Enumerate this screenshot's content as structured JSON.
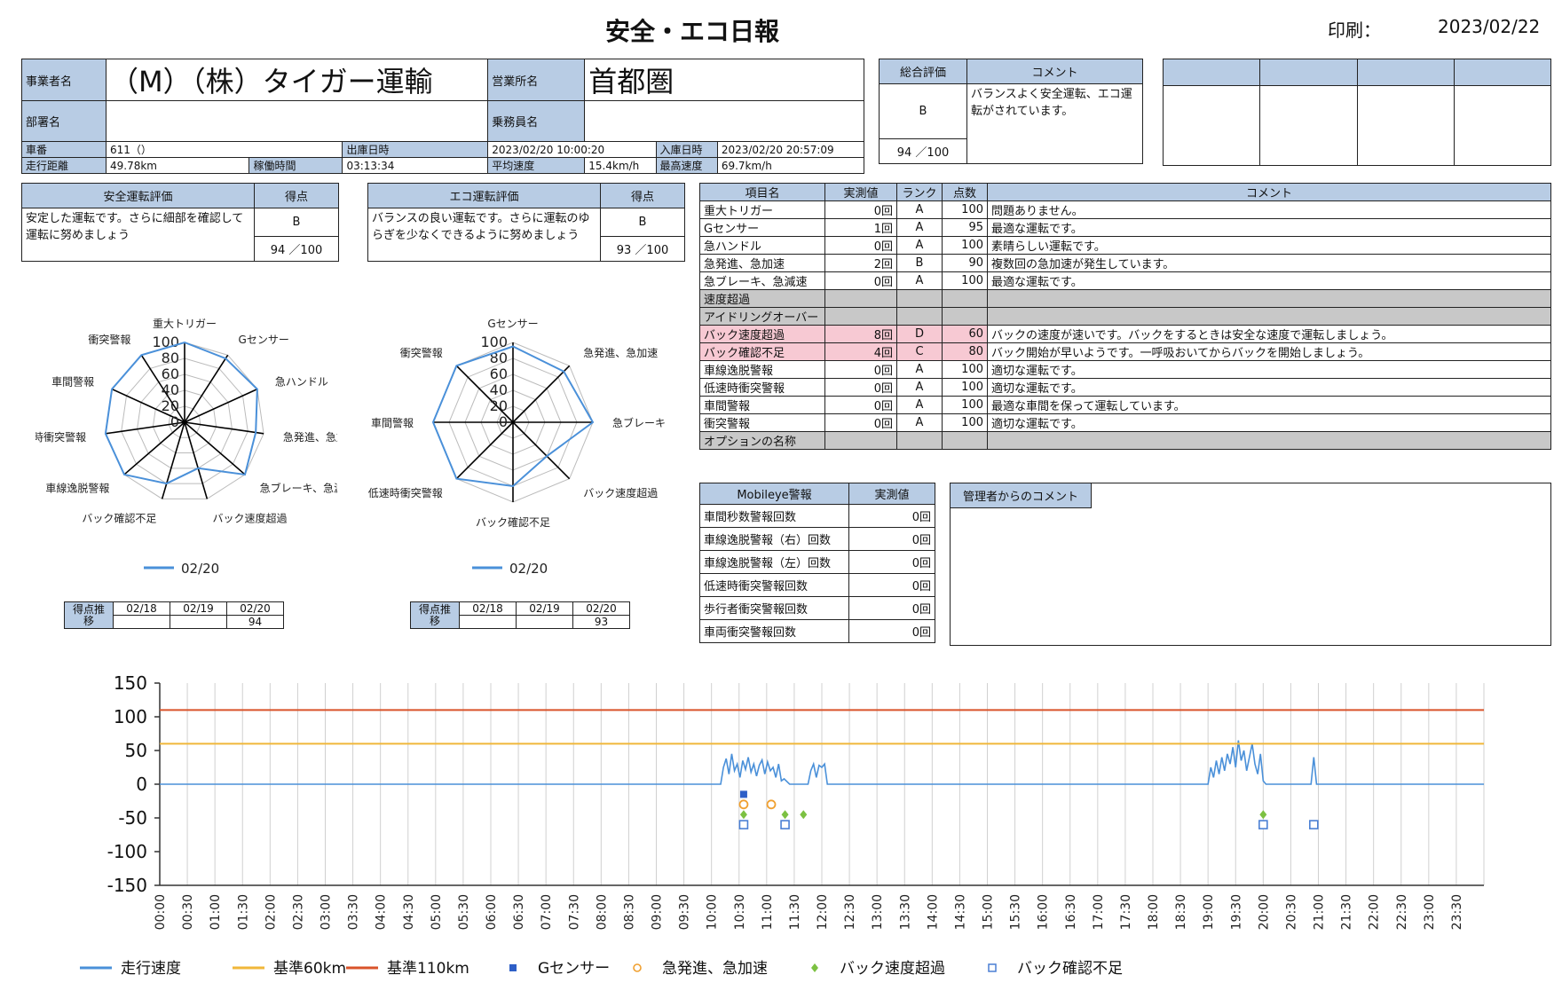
{
  "title": "安全・エコ日報",
  "print": {
    "label": "印刷：",
    "date": "2023/02/22"
  },
  "info": {
    "company_label": "事業者名",
    "company": "（M）（株）タイガー運輸",
    "office_label": "営業所名",
    "office": "首都圏",
    "dept_label": "部署名",
    "dept": "",
    "crew_label": "乗務員名",
    "crew": "",
    "car_label": "車番",
    "car": "611（）",
    "out_label": "出庫日時",
    "out": "2023/02/20 10:00:20",
    "in_label": "入庫日時",
    "in": "2023/02/20 20:57:09",
    "dist_label": "走行距離",
    "dist": "49.78km",
    "work_label": "稼働時間",
    "work": "03:13:34",
    "avg_label": "平均速度",
    "avg": "15.4km/h",
    "max_label": "最高速度",
    "max": "69.7km/h"
  },
  "overall": {
    "label": "総合評価",
    "comment_label": "コメント",
    "grade": "B",
    "score": "94 ／100",
    "comment": "バランスよく安全運転、エコ運転がされています。"
  },
  "safety": {
    "label": "安全運転評価",
    "score_label": "得点",
    "text": "安定した運転です。さらに細部を確認して運転に努めましょう",
    "grade": "B",
    "score": "94 ／100"
  },
  "eco": {
    "label": "エコ運転評価",
    "score_label": "得点",
    "text": "バランスの良い運転です。さらに運転のゆらぎを少なくできるように努めましょう",
    "grade": "B",
    "score": "93 ／100"
  },
  "items": {
    "headers": [
      "項目名",
      "実測値",
      "ランク",
      "点数",
      "コメント"
    ],
    "rows": [
      {
        "name": "重大トリガー",
        "val": "0回",
        "rank": "A",
        "pts": "100",
        "cmt": "問題ありません。",
        "style": ""
      },
      {
        "name": "Gセンサー",
        "val": "1回",
        "rank": "A",
        "pts": "95",
        "cmt": "最適な運転です。",
        "style": ""
      },
      {
        "name": "急ハンドル",
        "val": "0回",
        "rank": "A",
        "pts": "100",
        "cmt": "素晴らしい運転です。",
        "style": ""
      },
      {
        "name": "急発進、急加速",
        "val": "2回",
        "rank": "B",
        "pts": "90",
        "cmt": "複数回の急加速が発生しています。",
        "style": ""
      },
      {
        "name": "急ブレーキ、急減速",
        "val": "0回",
        "rank": "A",
        "pts": "100",
        "cmt": "最適な運転です。",
        "style": ""
      },
      {
        "name": "速度超過",
        "val": "",
        "rank": "",
        "pts": "",
        "cmt": "",
        "style": "gray"
      },
      {
        "name": "アイドリングオーバー",
        "val": "",
        "rank": "",
        "pts": "",
        "cmt": "",
        "style": "gray"
      },
      {
        "name": "バック速度超過",
        "val": "8回",
        "rank": "D",
        "pts": "60",
        "cmt": "バックの速度が速いです。バックをするときは安全な速度で運転しましょう。",
        "style": "pink"
      },
      {
        "name": "バック確認不足",
        "val": "4回",
        "rank": "C",
        "pts": "80",
        "cmt": "バック開始が早いようです。一呼吸おいてからバックを開始しましょう。",
        "style": "pink"
      },
      {
        "name": "車線逸脱警報",
        "val": "0回",
        "rank": "A",
        "pts": "100",
        "cmt": "適切な運転です。",
        "style": ""
      },
      {
        "name": "低速時衝突警報",
        "val": "0回",
        "rank": "A",
        "pts": "100",
        "cmt": "適切な運転です。",
        "style": ""
      },
      {
        "name": "車間警報",
        "val": "0回",
        "rank": "A",
        "pts": "100",
        "cmt": "最適な車間を保って運転しています。",
        "style": ""
      },
      {
        "name": "衝突警報",
        "val": "0回",
        "rank": "A",
        "pts": "100",
        "cmt": "適切な運転です。",
        "style": ""
      },
      {
        "name": "オプションの名称",
        "val": "",
        "rank": "",
        "pts": "",
        "cmt": "",
        "style": "gray"
      }
    ]
  },
  "mobileye": {
    "headers": [
      "Mobileye警報",
      "実測値"
    ],
    "rows": [
      {
        "name": "車間秒数警報回数",
        "val": "0回"
      },
      {
        "name": "車線逸脱警報（右）回数",
        "val": "0回"
      },
      {
        "name": "車線逸脱警報（左）回数",
        "val": "0回"
      },
      {
        "name": "低速時衝突警報回数",
        "val": "0回"
      },
      {
        "name": "歩行者衝突警報回数",
        "val": "0回"
      },
      {
        "name": "車両衝突警報回数",
        "val": "0回"
      }
    ]
  },
  "manager": {
    "label": "管理者からのコメント",
    "text": ""
  },
  "trend1": {
    "label": "得点推移",
    "dates": [
      "02/18",
      "02/19",
      "02/20"
    ],
    "scores": [
      "",
      "",
      "94"
    ]
  },
  "trend2": {
    "label": "得点推移",
    "dates": [
      "02/18",
      "02/19",
      "02/20"
    ],
    "scores": [
      "",
      "",
      "93"
    ]
  },
  "radar1": {
    "legend": "02/20",
    "labels": [
      "重大トリガー",
      "Gセンサー",
      "急ハンドル",
      "急発進、急加速",
      "急ブレーキ、急減速",
      "バック速度超過",
      "バック確認不足",
      "車線逸脱警報",
      "低速時衝突警報",
      "車間警報",
      "衝突警報"
    ],
    "values": [
      100,
      95,
      100,
      90,
      100,
      60,
      80,
      100,
      100,
      100,
      100
    ],
    "ticks": [
      "0",
      "20",
      "40",
      "60",
      "80",
      "100"
    ],
    "color": "#4a90d9"
  },
  "radar2": {
    "legend": "02/20",
    "labels": [
      "Gセンサー",
      "急発進、急加速",
      "急ブレーキ、急減速",
      "バック速度超過",
      "バック確認不足",
      "低速時衝突警報",
      "車間警報",
      "衝突警報"
    ],
    "values": [
      95,
      90,
      100,
      60,
      80,
      100,
      100,
      100
    ],
    "ticks": [
      "0",
      "20",
      "40",
      "60",
      "80",
      "100"
    ],
    "color": "#4a90d9"
  },
  "chart_data": {
    "type": "line",
    "ylim": [
      -150,
      150
    ],
    "yticks": [
      "150",
      "100",
      "50",
      "0",
      "-50",
      "-100",
      "-150"
    ],
    "xticks": [
      "00:00",
      "00:30",
      "01:00",
      "01:30",
      "02:00",
      "02:30",
      "03:00",
      "03:30",
      "04:00",
      "04:30",
      "05:00",
      "05:30",
      "06:00",
      "06:30",
      "07:00",
      "07:30",
      "08:00",
      "08:30",
      "09:00",
      "09:30",
      "10:00",
      "10:30",
      "11:00",
      "11:30",
      "12:00",
      "12:30",
      "13:00",
      "13:30",
      "14:00",
      "14:30",
      "15:00",
      "15:30",
      "16:00",
      "16:30",
      "17:00",
      "17:30",
      "18:00",
      "18:30",
      "19:00",
      "19:30",
      "20:00",
      "20:30",
      "21:00",
      "21:30",
      "22:00",
      "22:30",
      "23:00",
      "23:30"
    ],
    "series": [
      {
        "name": "走行速度",
        "color": "#4a90d9",
        "kind": "line",
        "x": [
          "10:10",
          "10:13",
          "10:16",
          "10:19",
          "10:22",
          "10:25",
          "10:28",
          "10:31",
          "10:34",
          "10:37",
          "10:40",
          "10:43",
          "10:46",
          "10:49",
          "10:52",
          "10:55",
          "10:58",
          "11:01",
          "11:04",
          "11:07",
          "11:10",
          "11:13",
          "11:16",
          "11:19",
          "11:25",
          "11:35",
          "11:45",
          "11:48",
          "11:51",
          "11:54",
          "11:57",
          "12:00",
          "12:03",
          "12:06",
          "12:10",
          "12:30",
          "19:00",
          "19:03",
          "19:06",
          "19:09",
          "19:12",
          "19:15",
          "19:18",
          "19:21",
          "19:24",
          "19:27",
          "19:30",
          "19:33",
          "19:36",
          "19:39",
          "19:42",
          "19:45",
          "19:48",
          "19:51",
          "19:54",
          "19:57",
          "20:00",
          "20:03",
          "20:30",
          "20:52",
          "20:55",
          "20:58",
          "21:05"
        ],
        "y": [
          0,
          25,
          38,
          15,
          45,
          20,
          30,
          10,
          35,
          22,
          40,
          18,
          30,
          12,
          28,
          36,
          15,
          33,
          20,
          25,
          10,
          30,
          5,
          8,
          0,
          0,
          0,
          20,
          30,
          10,
          28,
          25,
          30,
          0,
          0,
          0,
          0,
          25,
          10,
          35,
          15,
          40,
          20,
          45,
          30,
          55,
          25,
          65,
          35,
          50,
          20,
          40,
          60,
          30,
          15,
          45,
          5,
          0,
          0,
          0,
          40,
          0,
          0
        ]
      },
      {
        "name": "基準60km",
        "color": "#f0b73a",
        "kind": "hline",
        "value": 60
      },
      {
        "name": "基準110km",
        "color": "#d9532a",
        "kind": "hline",
        "value": 110
      },
      {
        "name": "Gセンサー",
        "color": "#2e5fc7",
        "kind": "square",
        "x": [
          "10:35"
        ],
        "y": [
          -15
        ]
      },
      {
        "name": "急発進、急加速",
        "color": "#f0a030",
        "kind": "circle",
        "x": [
          "10:35",
          "11:05"
        ],
        "y": [
          -30,
          -30
        ]
      },
      {
        "name": "バック速度超過",
        "color": "#7cc142",
        "kind": "diamond",
        "x": [
          "10:35",
          "11:20",
          "11:40",
          "20:00"
        ],
        "y": [
          -45,
          -45,
          -45,
          -45
        ]
      },
      {
        "name": "バック確認不足",
        "color": "#4a7fd4",
        "kind": "opensquare",
        "x": [
          "10:35",
          "11:20",
          "20:00",
          "20:55"
        ],
        "y": [
          -60,
          -60,
          -60,
          -60
        ]
      }
    ]
  }
}
